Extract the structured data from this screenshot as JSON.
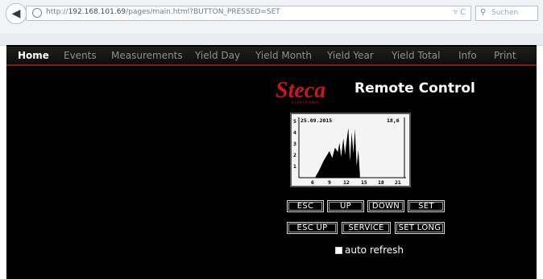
{
  "browser": {
    "url_prefix": "http://",
    "url_host": "192.168.101.69",
    "url_path": "/pages/main.html?BUTTON_PRESSED=SET",
    "url_controls": "▿ C",
    "search_placeholder": "Suchen"
  },
  "nav": {
    "items": [
      {
        "label": "Home"
      },
      {
        "label": "Events"
      },
      {
        "label": "Measurements"
      },
      {
        "label": "Yield Day"
      },
      {
        "label": "Yield Month"
      },
      {
        "label": "Yield Year"
      },
      {
        "label": "Yield Total"
      },
      {
        "label": "Info"
      },
      {
        "label": "Print"
      }
    ]
  },
  "header": {
    "logo_text": "Steca",
    "logo_subtext": "ELEKTRONIK",
    "title": "Remote Control"
  },
  "lcd": {
    "date": "25.09.2015",
    "value": "18,6",
    "y_ticks": [
      "5",
      "4",
      "3",
      "2",
      "1"
    ],
    "x_ticks": [
      "6",
      "9",
      "12",
      "15",
      "18",
      "21"
    ]
  },
  "chart_data": {
    "type": "area",
    "title": "",
    "x_range": [
      4,
      23
    ],
    "y_range": [
      0,
      5
    ],
    "x_ticks": [
      "6",
      "9",
      "12",
      "15",
      "18",
      "21"
    ],
    "y_ticks": [
      "1",
      "2",
      "3",
      "4",
      "5"
    ],
    "series": [
      {
        "x": [
          7.0,
          7.5,
          8.0,
          8.5,
          9.0,
          9.5,
          10.0,
          10.5,
          11.0,
          11.3,
          11.6,
          12.0,
          12.3,
          12.6,
          12.9,
          13.2,
          13.5,
          13.8,
          14.1,
          14.4,
          14.7,
          15.0
        ],
        "y": [
          0.1,
          0.5,
          1.0,
          1.5,
          1.9,
          2.3,
          1.7,
          2.6,
          2.2,
          3.0,
          1.8,
          3.4,
          2.0,
          3.2,
          4.3,
          1.4,
          3.9,
          2.1,
          4.2,
          1.0,
          2.4,
          0.2
        ]
      }
    ]
  },
  "buttons": {
    "esc": "ESC",
    "up": "UP",
    "down": "DOWN",
    "set": "SET",
    "esc_up": "ESC UP",
    "service": "SERVICE",
    "set_long": "SET LONG"
  },
  "auto_refresh": {
    "label": "auto refresh",
    "checked": true
  }
}
